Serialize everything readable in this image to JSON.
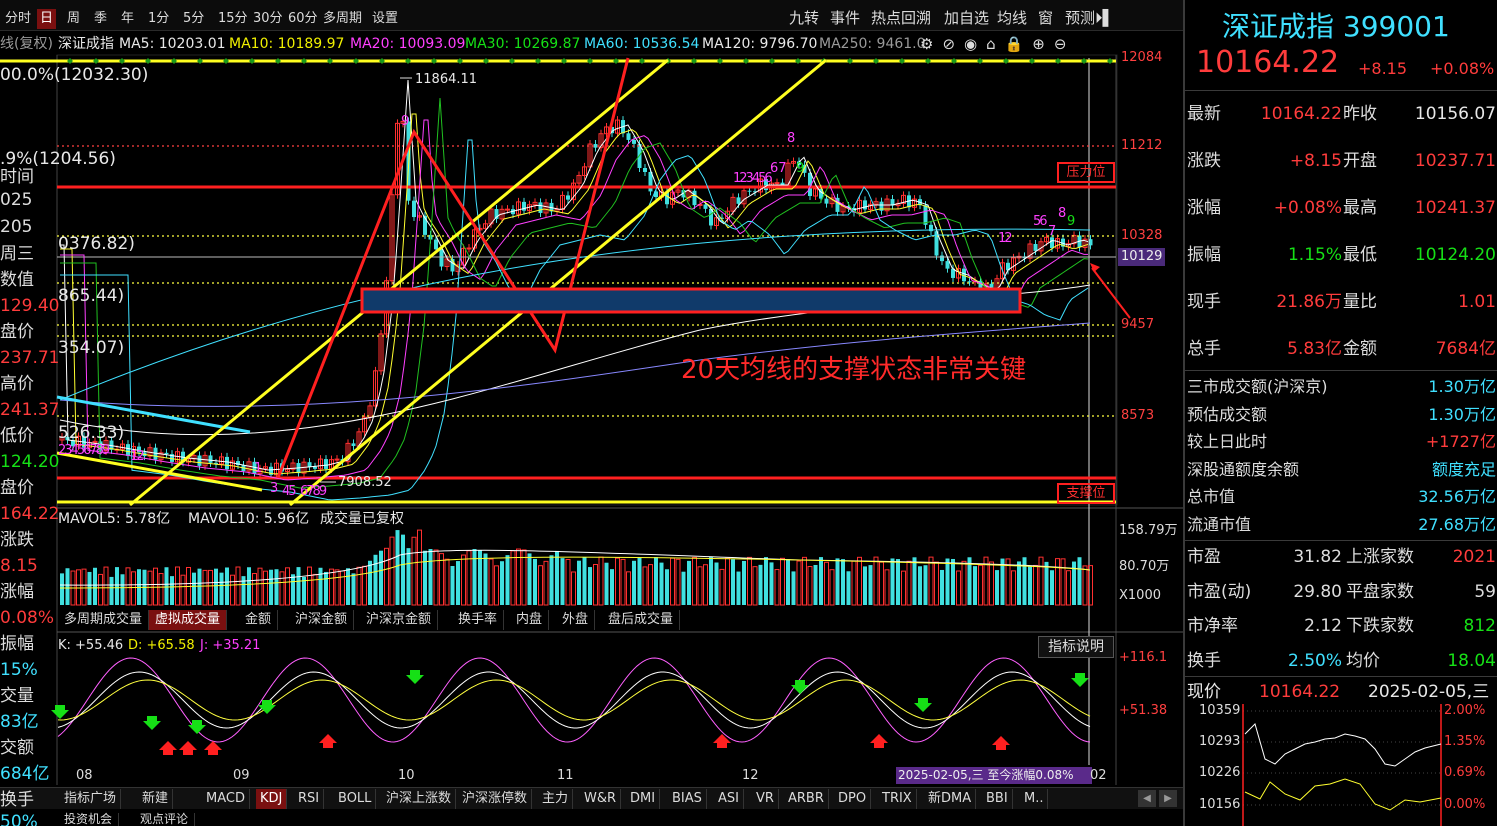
{
  "toolbar": {
    "periods": [
      "分时",
      "日",
      "周",
      "季",
      "年",
      "1分",
      "5分",
      "15分",
      "30分",
      "60分",
      "多周期",
      "设置"
    ],
    "active_period": "日",
    "tools": [
      "九转",
      "事件",
      "热点回溯",
      "加自选",
      "均线",
      "窗",
      "预测"
    ]
  },
  "ma_bar": {
    "mode": "线(复权)",
    "name": "深证成指",
    "ma5": "MA5: 10203.01",
    "ma10": "MA10: 10189.97",
    "ma20": "MA20: 10093.09",
    "ma30": "MA30: 10269.87",
    "ma60": "MA60: 10536.54",
    "ma120": "MA120: 9796.70",
    "ma250": "MA250: 9461.0"
  },
  "chart_labels": {
    "fib100": "00.0%(12032.30)",
    "fib2": ".9%(1204.56)",
    "fib3": "0376.82)",
    "fib4": "865.44)",
    "fib5": "354.07)",
    "fib6": "526.33)",
    "peak": "11864.11",
    "low": "7908.52",
    "pressure": "压力位",
    "support": "支撑位",
    "annotation": "20天均线的支撑状态非常关键"
  },
  "left_panel": [
    "时间",
    "025",
    "205",
    "周三",
    "数值",
    "129.40",
    "盘价",
    "237.71",
    "高价",
    "241.37",
    "低价",
    "124.20",
    "盘价",
    "164.22",
    "涨跌",
    "8.15",
    "涨幅",
    "0.08%",
    "振幅",
    "15%",
    "交量",
    "83亿",
    "交额",
    "684亿",
    "换手",
    "50%"
  ],
  "price_axis": [
    "12084",
    "11212",
    "10328",
    "10129",
    "9457",
    "8573"
  ],
  "vol_axis": [
    "158.79万",
    "80.70万",
    "X1000"
  ],
  "kdj_axis": [
    "+116.1",
    "+51.38"
  ],
  "months": [
    "08",
    "09",
    "10",
    "11",
    "12",
    "02"
  ],
  "date_tag": "2025-02-05,三 至今涨幅0.08%",
  "seq_nums": {
    "top": "9",
    "peak": "8",
    "mid": "123456",
    "r1": "67",
    "r2": "9",
    "r3": "12",
    "r4": "56",
    "r5": "7",
    "r6": "8",
    "r7": "9",
    "left": "23456789",
    "left2": "12",
    "left3": "1",
    "left4": "3",
    "left5": "45",
    "left6": "6789",
    "rise": "12345"
  },
  "vol_bar": {
    "mavol5": "MAVOL5: 5.78亿",
    "mavol10": "MAVOL10: 5.96亿",
    "note": "成交量已复权"
  },
  "vol_tabs": [
    "多周期成交量",
    "虚拟成交量",
    "金额",
    "沪深金额",
    "沪深京金额",
    "换手率",
    "内盘",
    "外盘",
    "盘后成交量"
  ],
  "kdj_bar": {
    "k": "K: +55.46",
    "d": "D: +65.58",
    "j": "J: +35.21"
  },
  "indicator_help": "指标说明",
  "bottom_tabs": [
    "指标广场",
    "新建",
    "MACD",
    "KDJ",
    "RSI",
    "BOLL",
    "沪深上涨数",
    "沪深涨停数",
    "主力",
    "W&R",
    "DMI",
    "BIAS",
    "ASI",
    "VR",
    "ARBR",
    "DPO",
    "TRIX",
    "新DMA",
    "BBI",
    "M.."
  ],
  "bottom2": [
    "投资机会",
    "观点评论"
  ],
  "quote": {
    "title": "深证成指 399001",
    "price": "10164.22",
    "chg": "+8.15",
    "pct": "+0.08%",
    "rows": [
      [
        "最新",
        "10164.22",
        "昨收",
        "10156.07"
      ],
      [
        "涨跌",
        "+8.15",
        "开盘",
        "10237.71"
      ],
      [
        "涨幅",
        "+0.08%",
        "最高",
        "10241.37"
      ],
      [
        "振幅",
        "1.15%",
        "最低",
        "10124.20"
      ],
      [
        "现手",
        "21.86万",
        "量比",
        "1.01"
      ],
      [
        "总手",
        "5.83亿",
        "金额",
        "7684亿"
      ]
    ],
    "stats": [
      [
        "三市成交额(沪深京)",
        "1.30万亿"
      ],
      [
        "预估成交额",
        "1.30万亿"
      ],
      [
        "较上日此时",
        "+1727亿"
      ],
      [
        "深股通额度余额",
        "额度充足"
      ],
      [
        "总市值",
        "32.56万亿"
      ],
      [
        "流通市值",
        "27.68万亿"
      ]
    ],
    "ratios": [
      [
        "市盈",
        "31.82",
        "上涨家数",
        "2021"
      ],
      [
        "市盈(动)",
        "29.80",
        "平盘家数",
        "59"
      ],
      [
        "市净率",
        "2.12",
        "下跌家数",
        "812"
      ],
      [
        "换手",
        "2.50%",
        "均价",
        "18.04"
      ]
    ],
    "mini": {
      "label": "现价",
      "price": "10164.22",
      "date": "2025-02-05,三",
      "y": [
        "10359",
        "10293",
        "10226",
        "10156"
      ],
      "pct": [
        "2.00%",
        "1.35%",
        "0.69%",
        "0.00%"
      ]
    }
  }
}
